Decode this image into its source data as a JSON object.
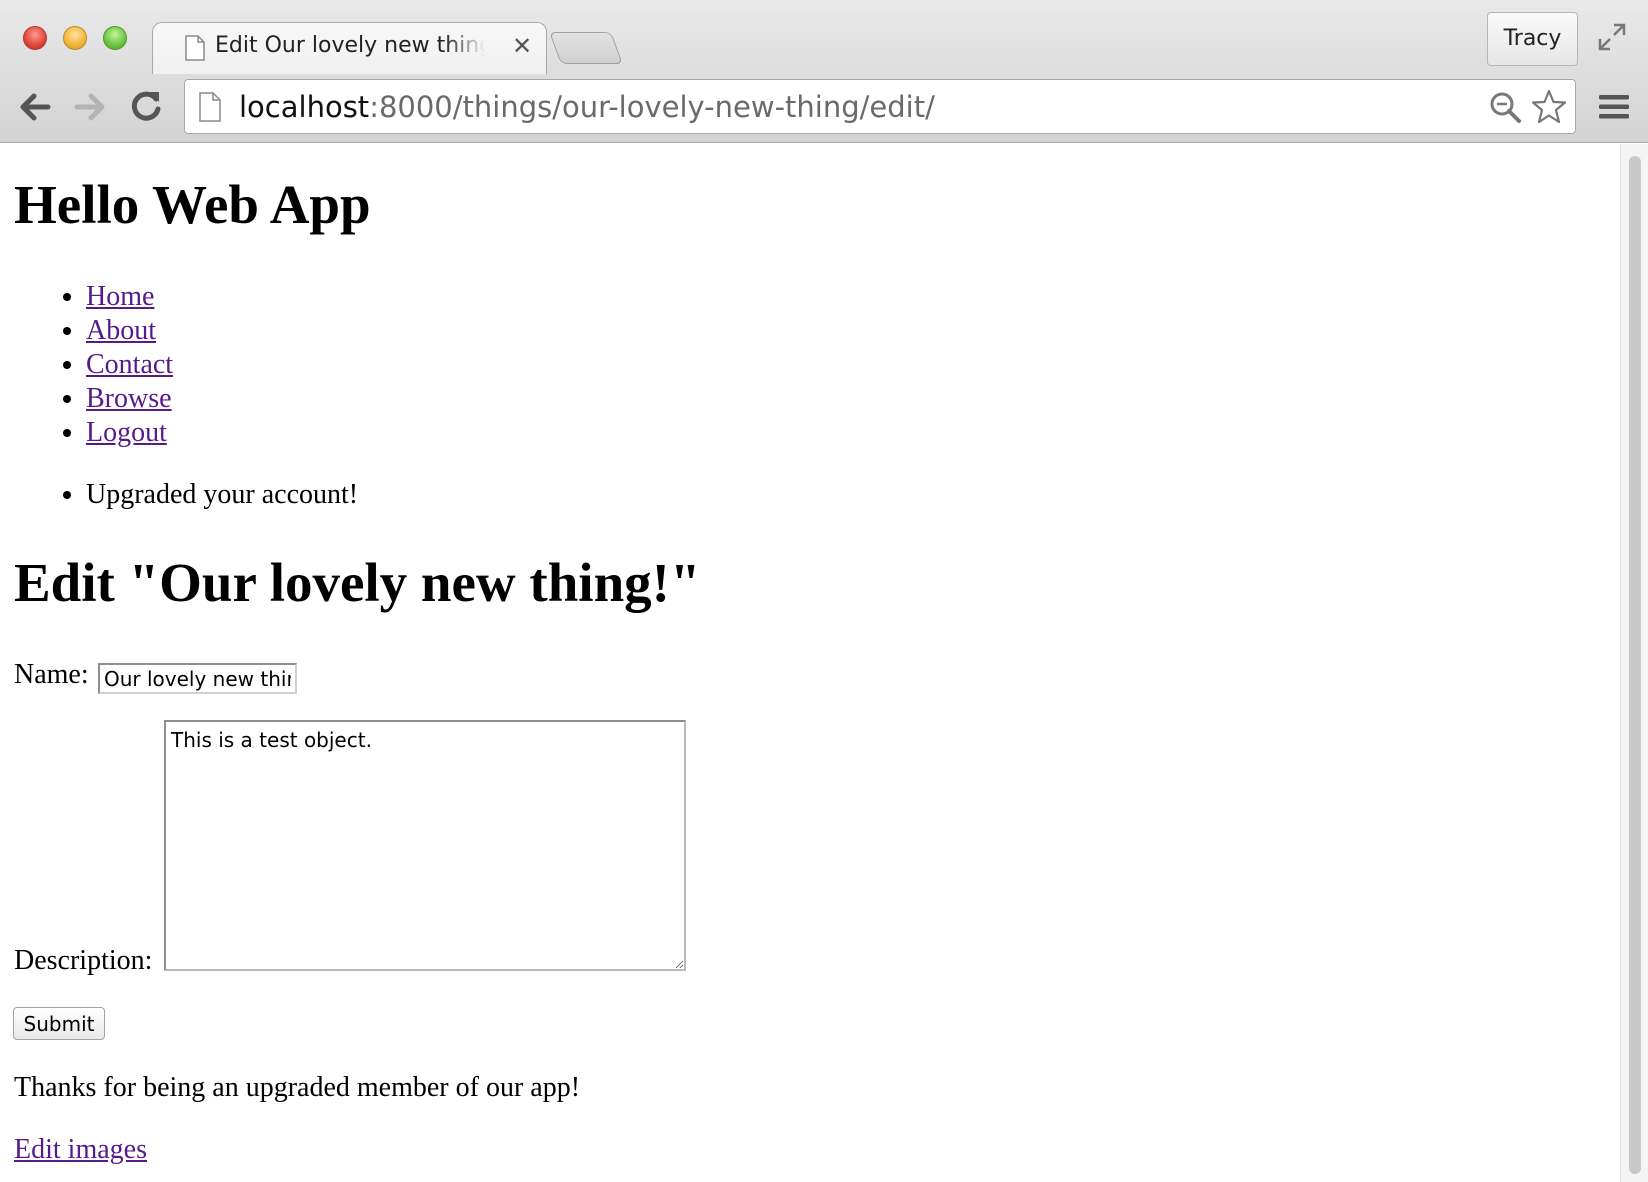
{
  "browser": {
    "tab": {
      "title": "Edit Our lovely new thing!",
      "close_glyph": "✕"
    },
    "profile_name": "Tracy",
    "address": {
      "host": "localhost",
      "path": ":8000/things/our-lovely-new-thing/edit/"
    },
    "icons": {
      "back": "back-arrow-icon",
      "forward": "forward-arrow-icon",
      "reload": "reload-icon",
      "page": "page-icon",
      "search": "search-icon",
      "bookmark": "star-icon",
      "menu": "hamburger-menu-icon",
      "fullscreen": "fullscreen-icon"
    }
  },
  "page": {
    "site_title": "Hello Web App",
    "nav": [
      "Home",
      "About",
      "Contact",
      "Browse",
      "Logout"
    ],
    "messages": [
      "Upgraded your account!"
    ],
    "heading": "Edit \"Our lovely new thing!\"",
    "form": {
      "name_label": "Name:",
      "name_value": "Our lovely new thing!",
      "description_label": "Description:",
      "description_value": "This is a test object.",
      "submit_label": "Submit"
    },
    "thanks_text": "Thanks for being an upgraded member of our app!",
    "edit_images_link": "Edit images"
  },
  "colors": {
    "link_visited": "#551a8b",
    "chrome_bg": "#d3d3d3"
  }
}
